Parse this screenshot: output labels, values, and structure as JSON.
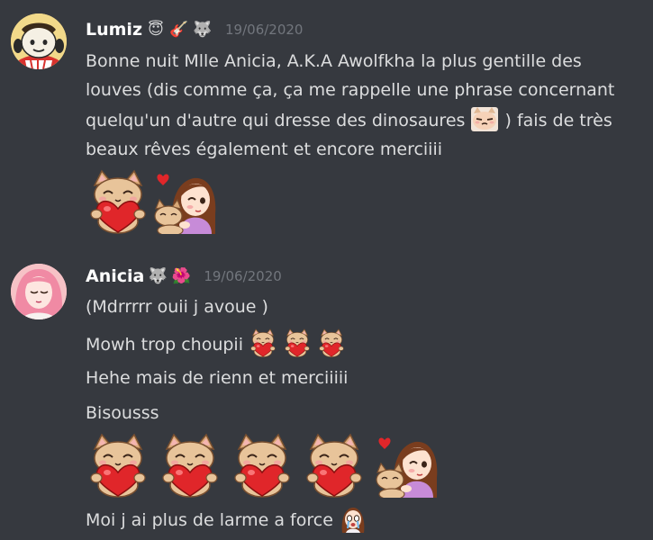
{
  "messages": [
    {
      "username": "Lumiz",
      "badges": [
        "😇",
        "🎸",
        "🐺"
      ],
      "timestamp": "19/06/2020",
      "lines": [
        "Bonne nuit Mlle Anicia, A.K.A Awolfkha la plus gentille des",
        "louves (dis comme ça, ça me rappelle une phrase concernant",
        "quelqu'un d'autre qui dresse des dinosaures",
        ") fais de très",
        "beaux rêves également et encore merciiii"
      ],
      "inline_emote": "smug-cat-emote",
      "big_emotes": [
        "cat-heart-emote",
        "girl-hug-cat-emote"
      ]
    },
    {
      "username": "Anicia",
      "badges": [
        "🐺",
        "🌺"
      ],
      "timestamp": "19/06/2020",
      "lines": [
        "(Mdrrrrr ouii j avoue )",
        "Mowh trop choupii",
        "Hehe mais de rienn et merciiiii",
        "Bisousss",
        "Moi j ai plus de larme a force"
      ],
      "inline_emotes_line2": [
        "cat-heart-emote",
        "cat-heart-emote",
        "cat-heart-emote"
      ],
      "big_emotes": [
        "cat-heart-emote",
        "cat-heart-emote",
        "cat-heart-emote",
        "cat-heart-emote",
        "girl-hug-cat-emote"
      ],
      "crying_emote": "crying-girl-emote"
    }
  ],
  "colors": {
    "background": "#36393f",
    "username": "#ffffff",
    "text": "#dcddde",
    "timestamp": "#72767d"
  }
}
